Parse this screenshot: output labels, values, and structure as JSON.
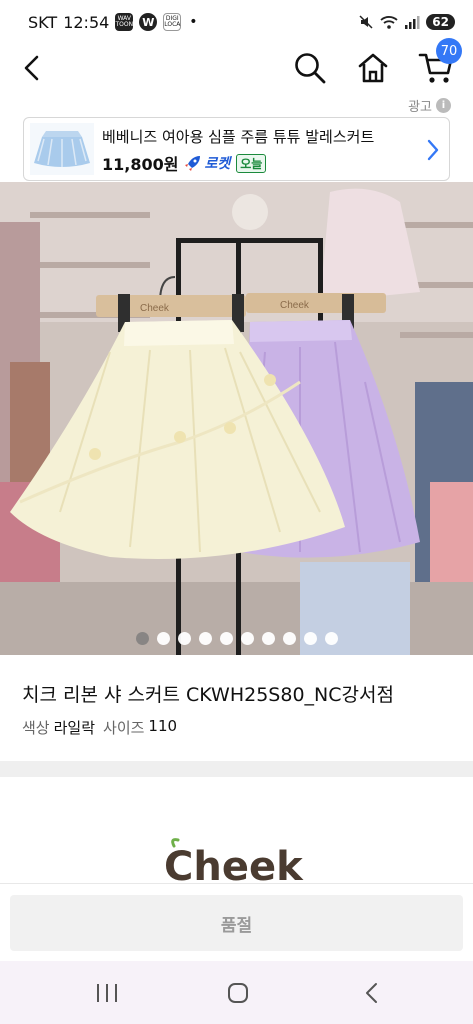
{
  "status_bar": {
    "carrier": "SKT",
    "time": "12:54",
    "app_icon_1": "WAV TOON",
    "app_icon_2": "W",
    "app_icon_3": "DIGI LOCA",
    "dot": "•",
    "battery": "62"
  },
  "top_nav": {
    "cart_count": "70"
  },
  "ad": {
    "label": "광고",
    "info": "i",
    "title": "베베니즈 여아용 심플 주름 튜튜 발레스커트",
    "price": "11,800원",
    "rocket": "로켓",
    "today": "오늘"
  },
  "product": {
    "title": "치크 리본 샤 스커트 CKWH25S80_NC강서점",
    "color_label": "색상",
    "color_value": "라일락",
    "size_label": "사이즈",
    "size_value": "110",
    "image_count": 10,
    "current_image": 1
  },
  "brand": {
    "logo_text": "Cheek"
  },
  "bottom": {
    "soldout_label": "품절"
  },
  "colors": {
    "accent_blue": "#3478f6",
    "rocket_blue": "#1f5bd6",
    "today_green": "#1b8a3c"
  },
  "icons": [
    "back-icon",
    "search-icon",
    "home-icon",
    "cart-icon",
    "chevron-right-icon",
    "info-icon",
    "rocket-icon"
  ]
}
